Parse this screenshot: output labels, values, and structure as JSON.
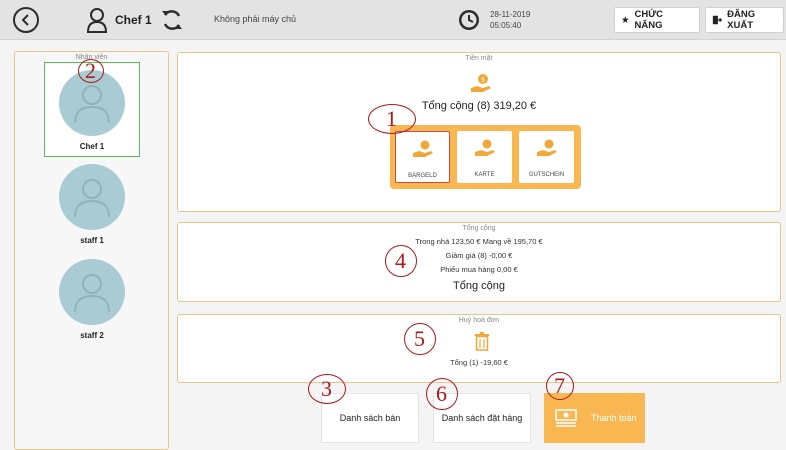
{
  "topbar": {
    "user_name": "Chef 1",
    "server_status": "Không phải máy chủ",
    "date": "28-11-2019",
    "time": "05:05:40",
    "function_label": "CHỨC NĂNG",
    "logout_label": "ĐĂNG XUẤT"
  },
  "sidebar": {
    "title": "Nhân viên",
    "staff": [
      {
        "name": "Chef 1",
        "selected": true
      },
      {
        "name": "staff 1",
        "selected": false
      },
      {
        "name": "staff 2",
        "selected": false
      }
    ]
  },
  "cash": {
    "title": "Tiền mặt",
    "total": "Tổng cộng (8) 319,20 €",
    "methods": [
      {
        "label": "BARGELD",
        "selected": true
      },
      {
        "label": "KARTE",
        "selected": false
      },
      {
        "label": "GUTSCHEIN",
        "selected": false
      }
    ]
  },
  "totals": {
    "title": "Tổng cộng",
    "line1": "Trong nhà 123,50 € Mang về 195,70 €",
    "line2": "Giảm giá (8) -0,00 €",
    "line3": "Phiếu mua hàng 0,00 €",
    "label": "Tổng cộng"
  },
  "cancel": {
    "title": "Huỷ hoá đơn",
    "total": "Tổng (1) -19,60 €"
  },
  "buttons": {
    "sales_list": "Danh sách bán",
    "order_list": "Danh sách đặt hàng",
    "payment": "Thanh toán"
  },
  "markers": [
    "1",
    "2",
    "3",
    "4",
    "5",
    "6",
    "7"
  ],
  "colors": {
    "accent": "#f9b752",
    "panel_border": "#e9c48c",
    "selected_border": "#5cb85c",
    "avatar": "#a9cbd3",
    "marker": "#b01818"
  }
}
